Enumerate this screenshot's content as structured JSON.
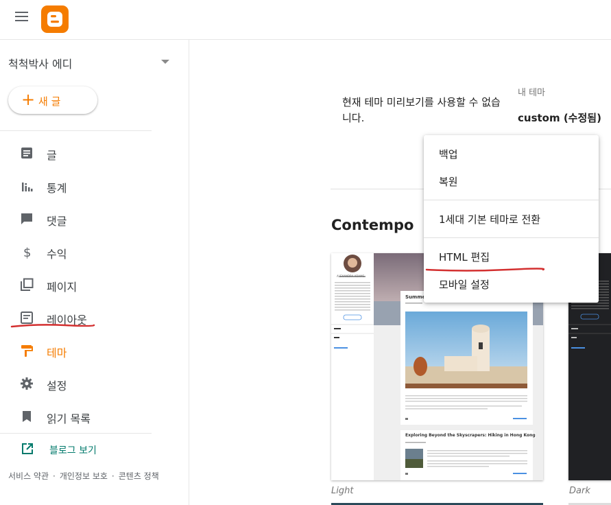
{
  "header": {
    "menu_icon": "hamburger-menu-icon",
    "logo_icon": "blogger-logo-icon",
    "accent": "#f57c00"
  },
  "sidebar": {
    "blog_name": "척척박사 에디",
    "new_post_label": "새 글",
    "items": [
      {
        "label": "글",
        "icon": "posts-icon"
      },
      {
        "label": "통계",
        "icon": "stats-icon"
      },
      {
        "label": "댓글",
        "icon": "comments-icon"
      },
      {
        "label": "수익",
        "icon": "earnings-icon"
      },
      {
        "label": "페이지",
        "icon": "pages-icon"
      },
      {
        "label": "레이아웃",
        "icon": "layout-icon"
      },
      {
        "label": "테마",
        "icon": "theme-icon",
        "active": true
      },
      {
        "label": "설정",
        "icon": "settings-icon"
      },
      {
        "label": "읽기 목록",
        "icon": "reading-list-icon"
      }
    ],
    "view_blog_label": "블로그 보기",
    "footer_links": [
      "서비스 약관",
      "개인정보 보호",
      "콘텐츠 정책"
    ]
  },
  "main": {
    "preview_unavailable": "현재 테마 미리보기를 사용할 수 없습니다.",
    "my_theme_label": "내 테마",
    "my_theme_name": "custom (수정됨)",
    "theme_section_title": "Contempo",
    "thumbnails": [
      {
        "caption": "Light",
        "profile_name": "ALEXANDRA ADAMS",
        "post1_title": "Summer",
        "post2_title": "Exploring Beyond the Skyscrapers: Hiking in Hong Kong",
        "archive_label": "Archive",
        "labels_label": "Labels",
        "report_abuse": "Report Abuse",
        "read_more": "READ MORE",
        "visit_profile": "VISIT PROFILE"
      },
      {
        "caption": "Dark"
      }
    ]
  },
  "dropdown_menu": {
    "items": [
      "백업",
      "복원",
      "1세대 기본 테마로 전환",
      "HTML 편집",
      "모바일 설정"
    ]
  }
}
